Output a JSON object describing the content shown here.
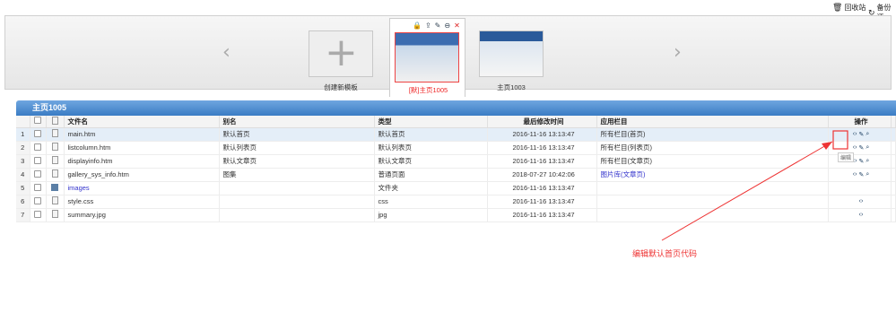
{
  "topbar": {
    "recycle": "回收站",
    "backup": "备份还"
  },
  "templates": {
    "new": "创建新模板",
    "active": "[默]主页1005",
    "other": "主页1003"
  },
  "grid": {
    "title": "主页1005",
    "headers": [
      "文件名",
      "别名",
      "类型",
      "最后修改时间",
      "应用栏目",
      "操作"
    ],
    "rows": [
      {
        "n": "1",
        "file": "main.htm",
        "alias": "默认首页",
        "type": "默认首页",
        "time": "2016-11-16 13:13:47",
        "col": "所有栏目(首页)",
        "icon": "file",
        "ops": "full"
      },
      {
        "n": "2",
        "file": "listcolumn.htm",
        "alias": "默认列表页",
        "type": "默认列表页",
        "time": "2016-11-16 13:13:47",
        "col": "所有栏目(列表页)",
        "icon": "file",
        "ops": "full"
      },
      {
        "n": "3",
        "file": "displayinfo.htm",
        "alias": "默认文章页",
        "type": "默认文章页",
        "time": "2016-11-16 13:13:47",
        "col": "所有栏目(文章页)",
        "icon": "file",
        "ops": "full"
      },
      {
        "n": "4",
        "file": "gallery_sys_info.htm",
        "alias": "图集",
        "type": "普通页面",
        "time": "2018-07-27 10:42:06",
        "col": "图片库(文章页)",
        "icon": "file",
        "ops": "full",
        "colLink": true
      },
      {
        "n": "5",
        "file": "images",
        "alias": "",
        "type": "文件夹",
        "time": "2016-11-16 13:13:47",
        "col": "",
        "icon": "folder",
        "ops": "none",
        "fileLink": true
      },
      {
        "n": "6",
        "file": "style.css",
        "alias": "",
        "type": "css",
        "time": "2016-11-16 13:13:47",
        "col": "",
        "icon": "doc",
        "ops": "view"
      },
      {
        "n": "7",
        "file": "summary.jpg",
        "alias": "",
        "type": "jpg",
        "time": "2016-11-16 13:13:47",
        "col": "",
        "icon": "doc",
        "ops": "view"
      }
    ]
  },
  "annotation": {
    "text": "编辑默认首页代码",
    "tooltip": "编辑"
  }
}
